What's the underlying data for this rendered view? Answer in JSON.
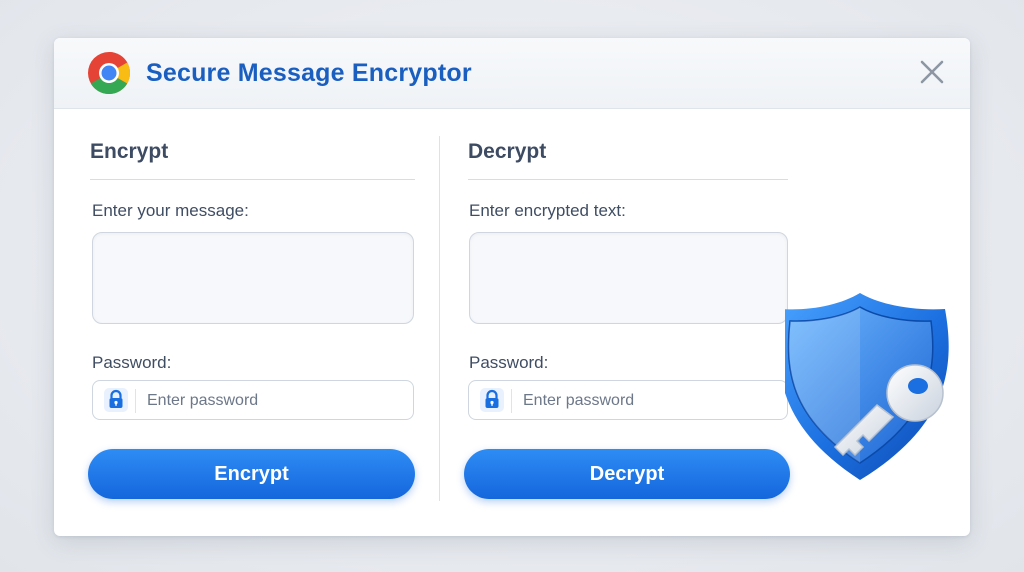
{
  "window": {
    "title": "Secure Message Encryptor",
    "browser_icon": "chrome-logo-icon",
    "close_icon": "close-icon"
  },
  "encrypt": {
    "heading": "Encrypt",
    "message_label": "Enter your message:",
    "message_value": "",
    "password_label": "Password:",
    "password_placeholder": "Enter password",
    "password_icon": "lock-icon",
    "button_label": "Encrypt"
  },
  "decrypt": {
    "heading": "Decrypt",
    "message_label": "Enter encrypted text:",
    "message_value": "",
    "password_label": "Password:",
    "password_placeholder": "Enter password",
    "password_icon": "lock-icon",
    "button_label": "Decrypt"
  },
  "illustration": {
    "icons": [
      "shield-icon",
      "key-icon"
    ]
  },
  "colors": {
    "accent": "#1a5fc0",
    "button": "#1f78e8",
    "text": "#3f4d63"
  }
}
